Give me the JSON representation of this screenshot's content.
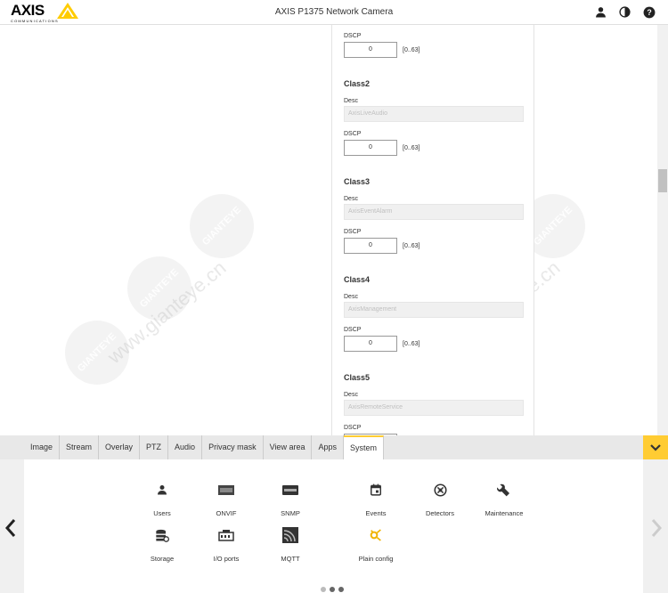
{
  "header": {
    "logo_text": "AXIS",
    "logo_sub": "COMMUNICATIONS",
    "title": "AXIS P1375 Network Camera",
    "icons": [
      "user-icon",
      "contrast-icon",
      "help-icon"
    ]
  },
  "panel": {
    "dscp_label": "DSCP",
    "desc_label": "Desc",
    "range": "[0..63]",
    "top_dscp_value": "0",
    "classes": [
      {
        "title": "Class2",
        "desc": "AxisLiveAudio",
        "dscp": "0"
      },
      {
        "title": "Class3",
        "desc": "AxisEventAlarm",
        "dscp": "0"
      },
      {
        "title": "Class4",
        "desc": "AxisManagement",
        "dscp": "0"
      },
      {
        "title": "Class5",
        "desc": "AxisRemoteService",
        "dscp": ""
      }
    ]
  },
  "watermark": {
    "badge": "GIANTEYE",
    "site": "www.gianteye.cn"
  },
  "tabs": [
    "Image",
    "Stream",
    "Overlay",
    "PTZ",
    "Audio",
    "Privacy mask",
    "View area",
    "Apps",
    "System"
  ],
  "active_tab": "System",
  "tiles": [
    {
      "label": "Users",
      "icon": "user-icon"
    },
    {
      "label": "ONVIF",
      "icon": "onvif-icon"
    },
    {
      "label": "SNMP",
      "icon": "snmp-icon"
    },
    {
      "label": "Events",
      "icon": "calendar-icon"
    },
    {
      "label": "Detectors",
      "icon": "detector-icon"
    },
    {
      "label": "Maintenance",
      "icon": "wrench-icon"
    },
    {
      "label": "Storage",
      "icon": "storage-icon"
    },
    {
      "label": "I/O ports",
      "icon": "io-ports-icon"
    },
    {
      "label": "MQTT",
      "icon": "mqtt-icon"
    },
    {
      "label": "Plain config",
      "icon": "plain-config-icon"
    }
  ],
  "colors": {
    "accent": "#ffcc33",
    "tabbar": "#e8e8e8"
  }
}
